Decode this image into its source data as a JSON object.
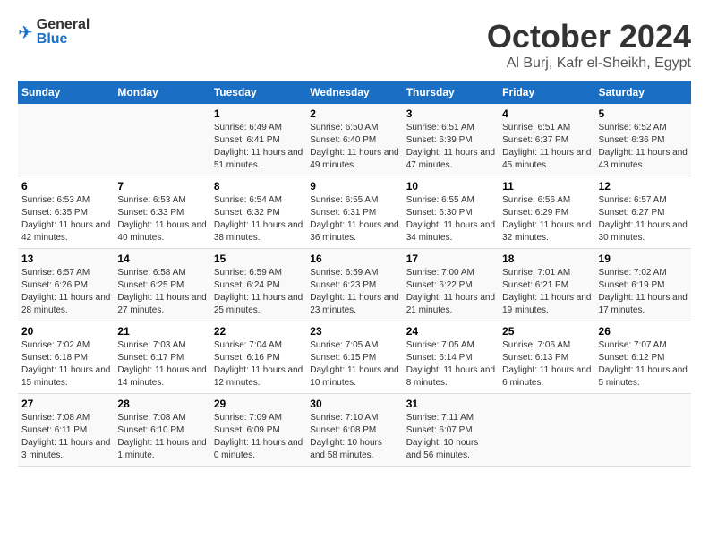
{
  "header": {
    "logo_general": "General",
    "logo_blue": "Blue",
    "month_title": "October 2024",
    "location": "Al Burj, Kafr el-Sheikh, Egypt"
  },
  "calendar": {
    "weekdays": [
      "Sunday",
      "Monday",
      "Tuesday",
      "Wednesday",
      "Thursday",
      "Friday",
      "Saturday"
    ],
    "weeks": [
      [
        {
          "day": "",
          "info": ""
        },
        {
          "day": "",
          "info": ""
        },
        {
          "day": "1",
          "info": "Sunrise: 6:49 AM\nSunset: 6:41 PM\nDaylight: 11 hours and 51 minutes."
        },
        {
          "day": "2",
          "info": "Sunrise: 6:50 AM\nSunset: 6:40 PM\nDaylight: 11 hours and 49 minutes."
        },
        {
          "day": "3",
          "info": "Sunrise: 6:51 AM\nSunset: 6:39 PM\nDaylight: 11 hours and 47 minutes."
        },
        {
          "day": "4",
          "info": "Sunrise: 6:51 AM\nSunset: 6:37 PM\nDaylight: 11 hours and 45 minutes."
        },
        {
          "day": "5",
          "info": "Sunrise: 6:52 AM\nSunset: 6:36 PM\nDaylight: 11 hours and 43 minutes."
        }
      ],
      [
        {
          "day": "6",
          "info": "Sunrise: 6:53 AM\nSunset: 6:35 PM\nDaylight: 11 hours and 42 minutes."
        },
        {
          "day": "7",
          "info": "Sunrise: 6:53 AM\nSunset: 6:33 PM\nDaylight: 11 hours and 40 minutes."
        },
        {
          "day": "8",
          "info": "Sunrise: 6:54 AM\nSunset: 6:32 PM\nDaylight: 11 hours and 38 minutes."
        },
        {
          "day": "9",
          "info": "Sunrise: 6:55 AM\nSunset: 6:31 PM\nDaylight: 11 hours and 36 minutes."
        },
        {
          "day": "10",
          "info": "Sunrise: 6:55 AM\nSunset: 6:30 PM\nDaylight: 11 hours and 34 minutes."
        },
        {
          "day": "11",
          "info": "Sunrise: 6:56 AM\nSunset: 6:29 PM\nDaylight: 11 hours and 32 minutes."
        },
        {
          "day": "12",
          "info": "Sunrise: 6:57 AM\nSunset: 6:27 PM\nDaylight: 11 hours and 30 minutes."
        }
      ],
      [
        {
          "day": "13",
          "info": "Sunrise: 6:57 AM\nSunset: 6:26 PM\nDaylight: 11 hours and 28 minutes."
        },
        {
          "day": "14",
          "info": "Sunrise: 6:58 AM\nSunset: 6:25 PM\nDaylight: 11 hours and 27 minutes."
        },
        {
          "day": "15",
          "info": "Sunrise: 6:59 AM\nSunset: 6:24 PM\nDaylight: 11 hours and 25 minutes."
        },
        {
          "day": "16",
          "info": "Sunrise: 6:59 AM\nSunset: 6:23 PM\nDaylight: 11 hours and 23 minutes."
        },
        {
          "day": "17",
          "info": "Sunrise: 7:00 AM\nSunset: 6:22 PM\nDaylight: 11 hours and 21 minutes."
        },
        {
          "day": "18",
          "info": "Sunrise: 7:01 AM\nSunset: 6:21 PM\nDaylight: 11 hours and 19 minutes."
        },
        {
          "day": "19",
          "info": "Sunrise: 7:02 AM\nSunset: 6:19 PM\nDaylight: 11 hours and 17 minutes."
        }
      ],
      [
        {
          "day": "20",
          "info": "Sunrise: 7:02 AM\nSunset: 6:18 PM\nDaylight: 11 hours and 15 minutes."
        },
        {
          "day": "21",
          "info": "Sunrise: 7:03 AM\nSunset: 6:17 PM\nDaylight: 11 hours and 14 minutes."
        },
        {
          "day": "22",
          "info": "Sunrise: 7:04 AM\nSunset: 6:16 PM\nDaylight: 11 hours and 12 minutes."
        },
        {
          "day": "23",
          "info": "Sunrise: 7:05 AM\nSunset: 6:15 PM\nDaylight: 11 hours and 10 minutes."
        },
        {
          "day": "24",
          "info": "Sunrise: 7:05 AM\nSunset: 6:14 PM\nDaylight: 11 hours and 8 minutes."
        },
        {
          "day": "25",
          "info": "Sunrise: 7:06 AM\nSunset: 6:13 PM\nDaylight: 11 hours and 6 minutes."
        },
        {
          "day": "26",
          "info": "Sunrise: 7:07 AM\nSunset: 6:12 PM\nDaylight: 11 hours and 5 minutes."
        }
      ],
      [
        {
          "day": "27",
          "info": "Sunrise: 7:08 AM\nSunset: 6:11 PM\nDaylight: 11 hours and 3 minutes."
        },
        {
          "day": "28",
          "info": "Sunrise: 7:08 AM\nSunset: 6:10 PM\nDaylight: 11 hours and 1 minute."
        },
        {
          "day": "29",
          "info": "Sunrise: 7:09 AM\nSunset: 6:09 PM\nDaylight: 11 hours and 0 minutes."
        },
        {
          "day": "30",
          "info": "Sunrise: 7:10 AM\nSunset: 6:08 PM\nDaylight: 10 hours and 58 minutes."
        },
        {
          "day": "31",
          "info": "Sunrise: 7:11 AM\nSunset: 6:07 PM\nDaylight: 10 hours and 56 minutes."
        },
        {
          "day": "",
          "info": ""
        },
        {
          "day": "",
          "info": ""
        }
      ]
    ]
  }
}
